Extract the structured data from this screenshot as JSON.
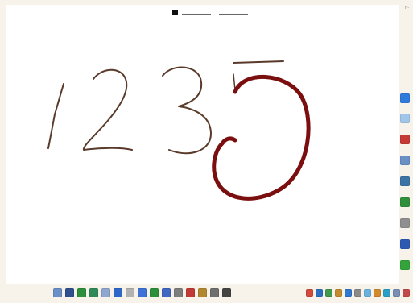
{
  "window": {
    "top_right_text": "r -   "
  },
  "canvas": {
    "strokes": [
      {
        "name": "digit-one-stroke",
        "color": "#5a3a2a"
      },
      {
        "name": "digit-two-stroke",
        "color": "#5a3a2a"
      },
      {
        "name": "digit-three-stroke",
        "color": "#5a3a2a"
      },
      {
        "name": "digit-five-top-stroke",
        "color": "#5a3a2a"
      },
      {
        "name": "digit-five-bowl-stroke",
        "color": "#7b0e0e"
      }
    ]
  },
  "toolbar": {
    "top_controls": [
      "pen-tool",
      "line-slot-1",
      "line-slot-2"
    ]
  },
  "side_dock": {
    "icons": [
      {
        "name": "side-app-icon-1",
        "color": "#2f7bdc"
      },
      {
        "name": "side-app-icon-2",
        "color": "#a2c6ea"
      },
      {
        "name": "side-app-icon-3",
        "color": "#c53a35"
      },
      {
        "name": "side-app-icon-4",
        "color": "#6a90c6"
      },
      {
        "name": "side-app-icon-5",
        "color": "#3c74a6"
      },
      {
        "name": "side-app-icon-6",
        "color": "#2f8f3b"
      },
      {
        "name": "side-app-icon-7",
        "color": "#8f8f8f"
      },
      {
        "name": "side-app-icon-8",
        "color": "#2d59b2"
      },
      {
        "name": "side-app-icon-9",
        "color": "#34a33b"
      }
    ]
  },
  "bottom_toolbar": {
    "icons": [
      {
        "name": "tool-icon-1",
        "color": "#6a8fc9"
      },
      {
        "name": "tool-icon-2",
        "color": "#2f4f8e"
      },
      {
        "name": "tool-icon-3",
        "color": "#2b8f3b"
      },
      {
        "name": "tool-icon-4",
        "color": "#2f8a5a"
      },
      {
        "name": "tool-icon-5",
        "color": "#8fa7cf"
      },
      {
        "name": "tool-icon-6",
        "color": "#2e67c8"
      },
      {
        "name": "tool-icon-7",
        "color": "#b2b2b2"
      },
      {
        "name": "tool-icon-8",
        "color": "#3d72d6"
      },
      {
        "name": "tool-icon-9",
        "color": "#2b8f3b"
      },
      {
        "name": "tool-icon-10",
        "color": "#3f66c1"
      },
      {
        "name": "tool-icon-11",
        "color": "#7d7d7d"
      },
      {
        "name": "tool-icon-12",
        "color": "#c13a35"
      },
      {
        "name": "tool-icon-13",
        "color": "#b0882f"
      },
      {
        "name": "tool-icon-14",
        "color": "#6f6f6f"
      },
      {
        "name": "tool-icon-15",
        "color": "#444444"
      }
    ]
  },
  "tray": {
    "icons": [
      {
        "name": "tray-icon-1",
        "color": "#d14a3b"
      },
      {
        "name": "tray-icon-2",
        "color": "#2b6fbf"
      },
      {
        "name": "tray-icon-3",
        "color": "#3f9a4e"
      },
      {
        "name": "tray-icon-4",
        "color": "#c38b2d"
      },
      {
        "name": "tray-icon-5",
        "color": "#2f77cf"
      },
      {
        "name": "tray-icon-6",
        "color": "#8a8a8a"
      },
      {
        "name": "tray-icon-7",
        "color": "#6bb1df"
      },
      {
        "name": "tray-icon-8",
        "color": "#d18b2d"
      },
      {
        "name": "tray-icon-9",
        "color": "#2aa0c9"
      },
      {
        "name": "tray-icon-10",
        "color": "#7a8fb4"
      },
      {
        "name": "tray-icon-11",
        "color": "#c34a4a"
      }
    ]
  }
}
